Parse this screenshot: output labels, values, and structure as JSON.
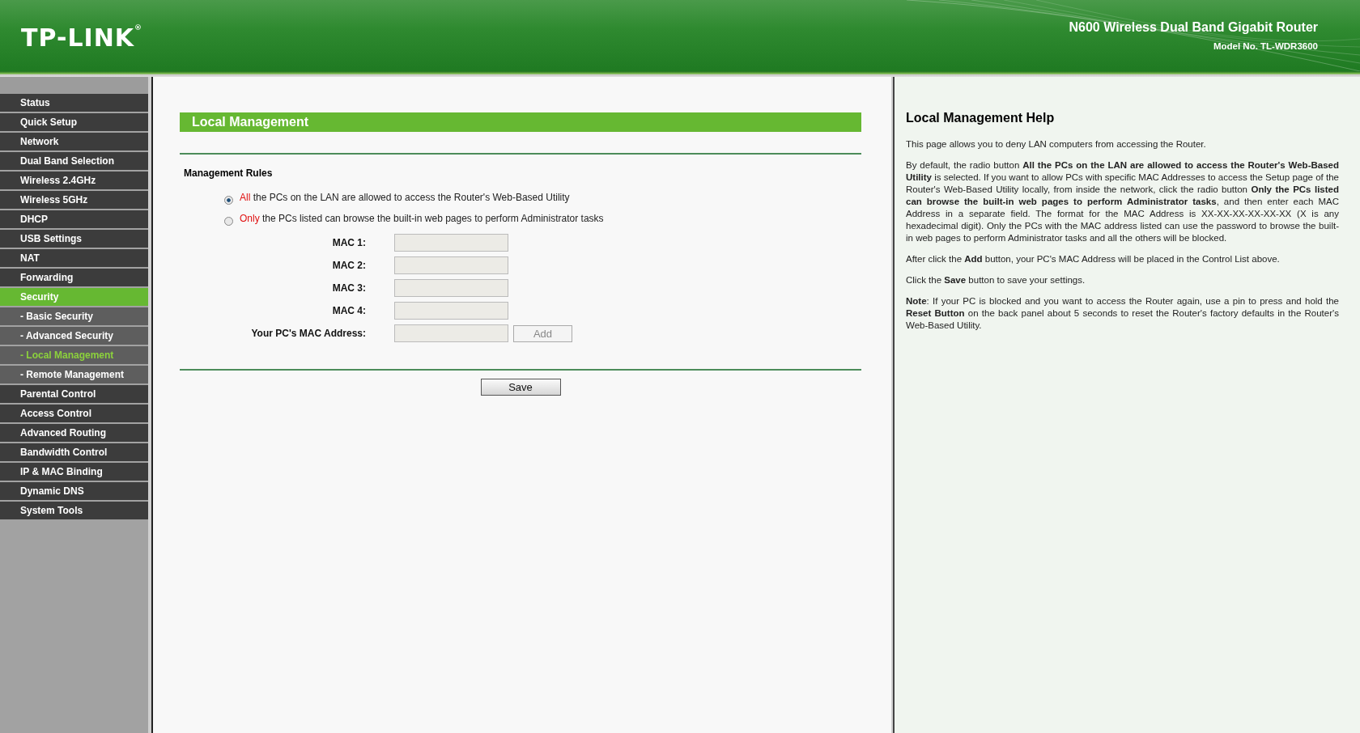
{
  "header": {
    "logo": "TP-LINK$^{®}$",
    "product": "N600 Wireless Dual Band Gigabit Router",
    "model": "Model No. TL-WDR3600"
  },
  "sidebar": {
    "items": [
      {
        "label": "Status",
        "kind": "main",
        "selected": false
      },
      {
        "label": "Quick Setup",
        "kind": "main",
        "selected": false
      },
      {
        "label": "Network",
        "kind": "main",
        "selected": false
      },
      {
        "label": "Dual Band Selection",
        "kind": "main",
        "selected": false
      },
      {
        "label": "Wireless 2.4GHz",
        "kind": "main",
        "selected": false
      },
      {
        "label": "Wireless 5GHz",
        "kind": "main",
        "selected": false
      },
      {
        "label": "DHCP",
        "kind": "main",
        "selected": false
      },
      {
        "label": "USB Settings",
        "kind": "main",
        "selected": false
      },
      {
        "label": "NAT",
        "kind": "main",
        "selected": false
      },
      {
        "label": "Forwarding",
        "kind": "main",
        "selected": false
      },
      {
        "label": "Security",
        "kind": "main",
        "selected": true
      },
      {
        "label": "- Basic Security",
        "kind": "sub",
        "selected": false
      },
      {
        "label": "- Advanced Security",
        "kind": "sub",
        "selected": false
      },
      {
        "label": "- Local Management",
        "kind": "sub",
        "selected": true
      },
      {
        "label": "- Remote Management",
        "kind": "sub",
        "selected": false
      },
      {
        "label": "Parental Control",
        "kind": "main",
        "selected": false
      },
      {
        "label": "Access Control",
        "kind": "main",
        "selected": false
      },
      {
        "label": "Advanced Routing",
        "kind": "main",
        "selected": false
      },
      {
        "label": "Bandwidth Control",
        "kind": "main",
        "selected": false
      },
      {
        "label": "IP & MAC Binding",
        "kind": "main",
        "selected": false
      },
      {
        "label": "Dynamic DNS",
        "kind": "main",
        "selected": false
      },
      {
        "label": "System Tools",
        "kind": "main",
        "selected": false
      }
    ]
  },
  "main": {
    "title": "Local Management",
    "section": "Management Rules",
    "options": [
      {
        "lead": "All",
        "text": " the PCs on the LAN are allowed to access the Router's Web-Based Utility",
        "selected": true
      },
      {
        "lead": "Only",
        "text": " the PCs listed can browse the built-in web pages to perform Administrator tasks",
        "selected": false
      }
    ],
    "fields": [
      {
        "label": "MAC 1:",
        "disabled": true
      },
      {
        "label": "MAC 2:",
        "disabled": true
      },
      {
        "label": "MAC 3:",
        "disabled": true
      },
      {
        "label": "MAC 4:",
        "disabled": true
      },
      {
        "label": "Your PC's MAC Address:",
        "disabled": true,
        "button": {
          "label": "Add",
          "disabled": true
        }
      }
    ],
    "save_button": "Save"
  },
  "help": {
    "title": "Local Management Help",
    "paragraphs": [
      "This page allows you to deny LAN computers from accessing the Router.",
      "By default, the radio button **All the PCs on the LAN are allowed to access the Router's Web-Based Utility** is selected. If you want to allow PCs with specific MAC Addresses to access the Setup page of the Router's Web-Based Utility locally, from inside the network, click the radio button **Only the PCs listed can browse the built-in web pages to perform Administrator tasks**, and then enter each MAC Address in a separate field. The format for the MAC Address is XX-XX-XX-XX-XX-XX (X is any hexadecimal digit). Only the PCs with the MAC address listed can use the password to browse the built-in web pages to perform Administrator tasks and all the others will be blocked.",
      "After click the **Add** button, your PC's MAC Address will be placed in the Control List above.",
      "Click the **Save** button to save your settings.",
      "**Note**: If your PC is blocked and you want to access the Router again, use a pin to press and hold the **Reset Button** on the back panel about 5 seconds to reset the Router's factory defaults in the Router's Web-Based Utility."
    ]
  }
}
